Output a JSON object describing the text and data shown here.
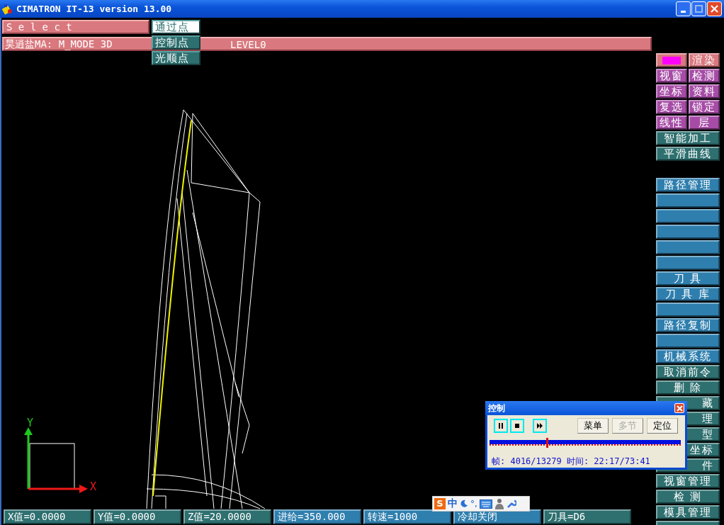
{
  "window": {
    "title": "CIMATRON IT-13 version 13.00"
  },
  "command_bar": {
    "prompt": "S e l e c t"
  },
  "point_menu": [
    {
      "label": "通过点",
      "selected": true
    },
    {
      "label": "控制点",
      "selected": false
    },
    {
      "label": "光顺点",
      "selected": false
    }
  ],
  "mode_bar": {
    "mode": "昊逍盐MA: M_MODE 3D",
    "layer": "LEVEL0"
  },
  "viewport": {
    "axes": {
      "x_label": "X",
      "y_label": "Y"
    }
  },
  "side_panel": [
    {
      "kind": "pair",
      "buttons": [
        {
          "kind": "swatch",
          "color": "#ff00ff"
        },
        {
          "kind": "label",
          "label": "渲染",
          "color": "#d9787e"
        }
      ]
    },
    {
      "kind": "pair",
      "buttons": [
        {
          "kind": "label",
          "label": "视窗",
          "color": "#a64ca6"
        },
        {
          "kind": "label",
          "label": "检测",
          "color": "#a64ca6"
        }
      ]
    },
    {
      "kind": "pair",
      "buttons": [
        {
          "kind": "label",
          "label": "坐标",
          "color": "#a64ca6"
        },
        {
          "kind": "label",
          "label": "资料",
          "color": "#a64ca6"
        }
      ]
    },
    {
      "kind": "pair",
      "buttons": [
        {
          "kind": "label",
          "label": "复选",
          "color": "#a64ca6"
        },
        {
          "kind": "label",
          "label": "锁定",
          "color": "#a64ca6"
        }
      ]
    },
    {
      "kind": "pair",
      "buttons": [
        {
          "kind": "label",
          "label": "线性",
          "color": "#a64ca6"
        },
        {
          "kind": "label",
          "label": "层",
          "color": "#a64ca6"
        }
      ]
    },
    {
      "kind": "single",
      "label": "智能加工",
      "color": "#2e6f6f"
    },
    {
      "kind": "single",
      "label": "平滑曲线",
      "color": "#2e6f6f"
    },
    {
      "kind": "gap"
    },
    {
      "kind": "single",
      "label": "路径管理",
      "color": "#2f7fae"
    },
    {
      "kind": "blank",
      "color": "#2f7fae"
    },
    {
      "kind": "blank",
      "color": "#2f7fae"
    },
    {
      "kind": "blank",
      "color": "#2f7fae"
    },
    {
      "kind": "blank",
      "color": "#2f7fae"
    },
    {
      "kind": "blank",
      "color": "#2f7fae"
    },
    {
      "kind": "single",
      "label": "刀 具",
      "color": "#2f7fae"
    },
    {
      "kind": "single",
      "label": "刀 具 库",
      "color": "#2f7fae"
    },
    {
      "kind": "blank",
      "color": "#2f7fae"
    },
    {
      "kind": "single",
      "label": "路径复制",
      "color": "#2f7fae"
    },
    {
      "kind": "blank",
      "color": "#2f7fae"
    },
    {
      "kind": "single",
      "label": "机械系统",
      "color": "#2f7fae"
    },
    {
      "kind": "single",
      "label": "取消前令",
      "color": "#2e6f6f"
    },
    {
      "kind": "single",
      "label": "删 除",
      "color": "#2e6f6f"
    },
    {
      "kind": "partial",
      "label": "藏",
      "color": "#2e6f6f"
    },
    {
      "kind": "partial",
      "label": "理",
      "color": "#2e6f6f"
    },
    {
      "kind": "partial",
      "label": "型",
      "color": "#2e6f6f"
    },
    {
      "kind": "partial",
      "label": "坐标",
      "color": "#2e6f6f"
    },
    {
      "kind": "partial",
      "label": "件",
      "color": "#2e6f6f"
    },
    {
      "kind": "single",
      "label": "视窗管理",
      "color": "#2e6f6f"
    },
    {
      "kind": "single",
      "label": "检 测",
      "color": "#2e6f6f"
    },
    {
      "kind": "single",
      "label": "模具管理",
      "color": "#2e6f6f"
    },
    {
      "kind": "blank",
      "color": "#2e6f6f"
    }
  ],
  "status_bar": [
    {
      "label": "X值=0.0000",
      "color": "#2e6f6f"
    },
    {
      "label": "Y值=0.0000",
      "color": "#2e6f6f"
    },
    {
      "label": "Z值=20.0000",
      "color": "#2e6f6f"
    },
    {
      "label": "进给=350.000",
      "color": "#2f7fae"
    },
    {
      "label": "转速=1000",
      "color": "#2f7fae"
    },
    {
      "label": "冷却关闭",
      "color": "#2f7fae"
    },
    {
      "label": "刀具=D6",
      "color": "#2e6f6f"
    }
  ],
  "ime_toolbar": {
    "logo": "S",
    "mode": "中",
    "punctuation": "°,"
  },
  "playback_dialog": {
    "title": "控制",
    "buttons": [
      {
        "kind": "pause"
      },
      {
        "kind": "stop"
      },
      {
        "kind": "forward"
      },
      {
        "kind": "text",
        "label": "菜单",
        "disabled": false
      },
      {
        "kind": "text",
        "label": "多节",
        "disabled": true
      },
      {
        "kind": "text",
        "label": "定位",
        "disabled": false
      }
    ],
    "progress": {
      "level": 0.3
    },
    "info": "帧: 4016/13279 时间: 22:17/73:41"
  }
}
